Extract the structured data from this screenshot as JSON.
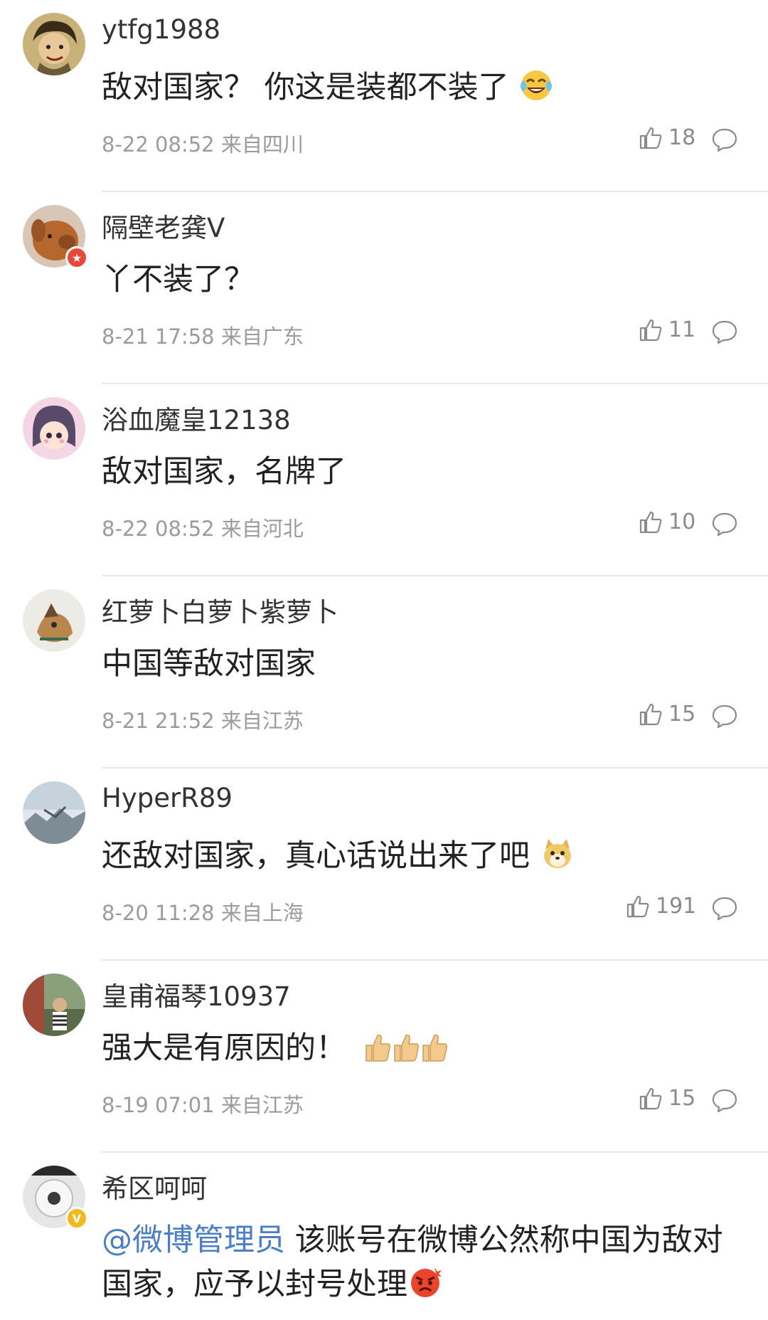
{
  "colors": {
    "mention": "#4a7ec7",
    "meta": "#9b9b9b",
    "divider": "#e8e8e8"
  },
  "comments": [
    {
      "username": "ytfg1988",
      "text": "敌对国家？ 你这是装都不装了",
      "emoji": "laughing-tears-emoji",
      "time": "8-22 08:52",
      "location": "来自四川",
      "likes": "18"
    },
    {
      "username": "隔壁老龚V",
      "text": "丫不装了？",
      "badge": "red-star-badge",
      "time": "8-21 17:58",
      "location": "来自广东",
      "likes": "11"
    },
    {
      "username": "浴血魔皇12138",
      "text": "敌对国家，名牌了",
      "time": "8-22 08:52",
      "location": "来自河北",
      "likes": "10"
    },
    {
      "username": "红萝卜白萝卜紫萝卜",
      "text": "中国等敌对国家",
      "time": "8-21 21:52",
      "location": "来自江苏",
      "likes": "15"
    },
    {
      "username": "HyperR89",
      "text": "还敌对国家，真心话说出来了吧",
      "emoji": "doge-emoji",
      "time": "8-20 11:28",
      "location": "来自上海",
      "likes": "191"
    },
    {
      "username": "皇甫福琴10937",
      "text": "强大是有原因的！",
      "emoji": "thumbs-up-emoji x3",
      "time": "8-19 07:01",
      "location": "来自江苏",
      "likes": "15"
    },
    {
      "username": "希区呵呵",
      "mention": "@微博管理员",
      "text": " 该账号在微博公然称中国为敌对国家，应予以封号处理",
      "badge": "yellow-v-badge",
      "emoji": "angry-emoji"
    }
  ]
}
